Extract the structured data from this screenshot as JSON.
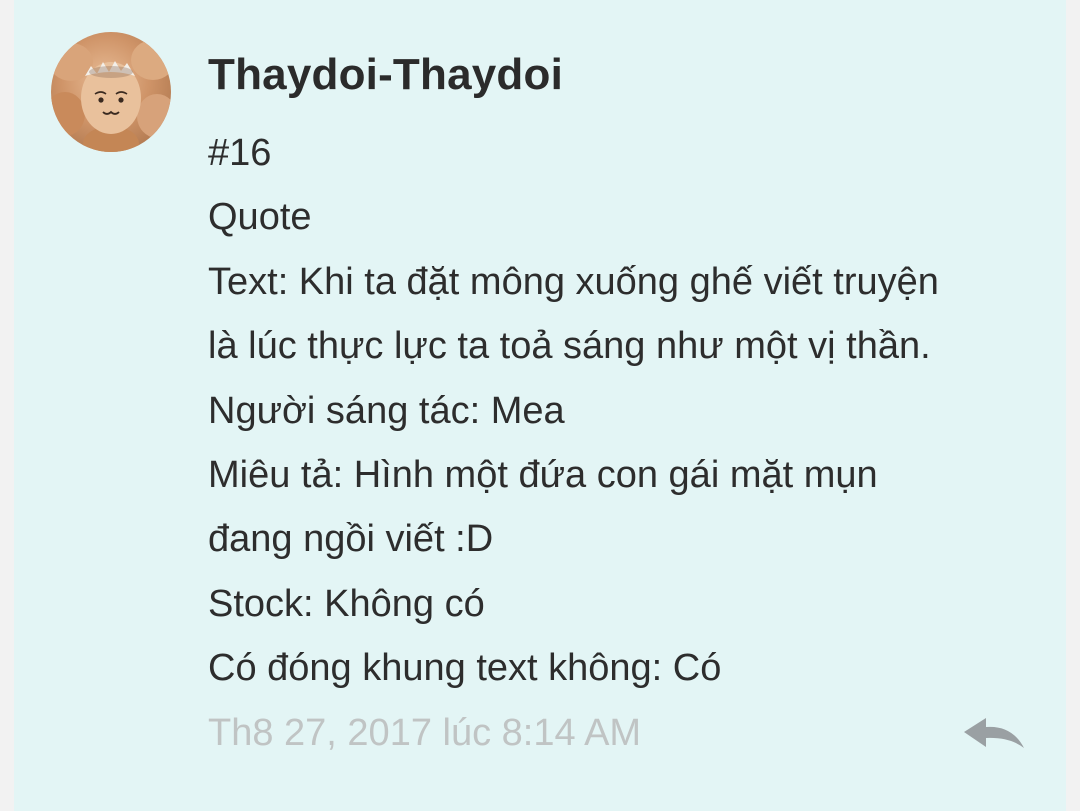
{
  "post": {
    "author": "Thaydoi-Thaydoi",
    "post_number": "#16",
    "lines": [
      "Quote",
      "Text: Khi ta đặt mông xuống ghế viết truyện",
      "là lúc thực lực ta toả sáng như một vị thần.",
      "Người sáng tác: Mea",
      "Miêu tả: Hình một đứa con gái mặt mụn",
      "đang ngồi viết :D",
      "Stock: Không có",
      "Có đóng khung text không: Có"
    ],
    "timestamp": "Th8 27, 2017 lúc 8:14 AM"
  },
  "icons": {
    "avatar": "egg-avatar-image",
    "reply": "reply-arrow-icon"
  },
  "colors": {
    "card_background": "#e3f5f5",
    "text": "#2d2d2d",
    "timestamp": "#c0c4c4",
    "reply_icon": "#9aa0a3"
  }
}
